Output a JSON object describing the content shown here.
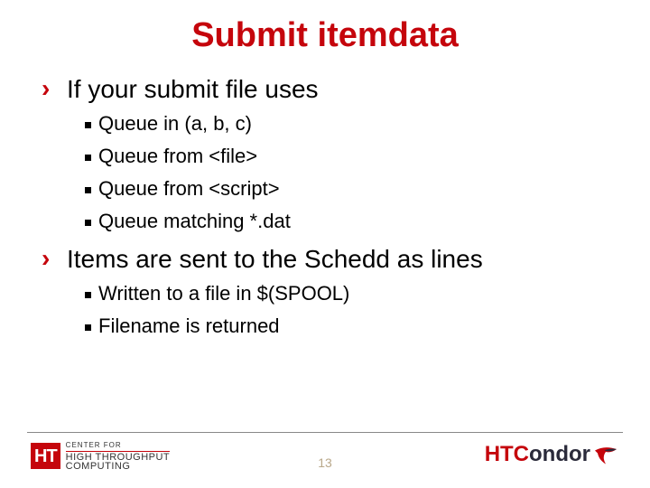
{
  "title": "Submit itemdata",
  "bullets": {
    "b1": {
      "text": "If your submit file uses",
      "sub": [
        "Queue in (a, b, c)",
        "Queue from <file>",
        "Queue from <script>",
        "Queue matching *.dat"
      ]
    },
    "b2": {
      "text": "Items are sent to the Schedd as lines",
      "sub": [
        "Written to a file in $(SPOOL)",
        "Filename is returned"
      ]
    }
  },
  "footer": {
    "page_number": "13",
    "logo_left": {
      "badge": "HT",
      "line1": "CENTER FOR",
      "line2": "HIGH THROUGHPUT",
      "line3": "COMPUTING"
    },
    "logo_right": {
      "part1": "HTC",
      "part2": "ondor"
    }
  }
}
